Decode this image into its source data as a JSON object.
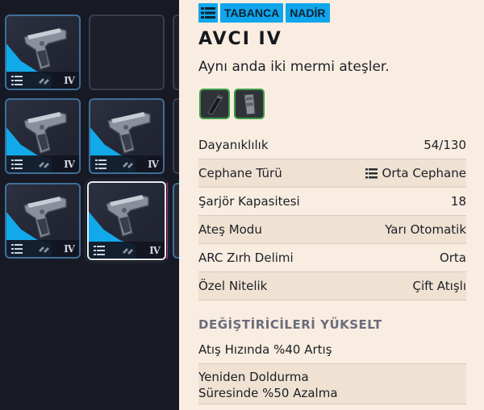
{
  "item": {
    "tags": [
      "TABANCA",
      "NADİR"
    ],
    "name": "AVCI IV",
    "description": "Aynı anda iki mermi ateşler.",
    "mods": [
      "mod-barrel-icon",
      "mod-magazine-icon"
    ]
  },
  "stats": [
    {
      "label": "Dayanıklılık",
      "value": "54/130"
    },
    {
      "label": "Cephane Türü",
      "value": "Orta Cephane",
      "icon": "ammo-list-icon"
    },
    {
      "label": "Şarjör Kapasitesi",
      "value": "18"
    },
    {
      "label": "Ateş Modu",
      "value": "Yarı Otomatik"
    },
    {
      "label": "ARC Zırh Delimi",
      "value": "Orta"
    },
    {
      "label": "Özel Nitelik",
      "value": "Çift Atışlı"
    }
  ],
  "upgrades": {
    "title": "DEĞİŞTİRİCİLERİ YÜKSELT",
    "items": [
      "Atış Hızında %40 Artış",
      "Yeniden Doldurma Süresinde %50 Azalma"
    ],
    "item2_line1": "Yeniden Doldurma",
    "item2_line2": "Süresinde %50 Azalma"
  },
  "inventory": {
    "slot_tier": "IV",
    "slot_icons": [
      "ammo-list-icon",
      "swap-icon"
    ]
  },
  "colors": {
    "rarity_blue": "#12a9ea",
    "panel_bg": "#f8ede0",
    "mod_border": "#3d9a48"
  }
}
